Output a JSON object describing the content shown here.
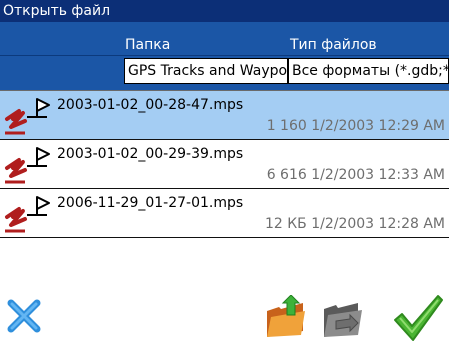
{
  "window": {
    "title": "Открыть файл"
  },
  "filters": {
    "folder_label": "Папка",
    "folder_value": "GPS Tracks and Waypoints",
    "type_label": "Тип файлов",
    "type_value": "Все форматы (*.gdb;*.mps)"
  },
  "files": [
    {
      "name": "2003-01-02_00-28-47.mps",
      "details": "1 160 1/2/2003 12:29 AM",
      "selected": true,
      "icon": "gps-track-file-icon"
    },
    {
      "name": "2003-01-02_00-29-39.mps",
      "details": "6 616 1/2/2003 12:33 AM",
      "selected": false,
      "icon": "gps-track-file-icon"
    },
    {
      "name": "2006-11-29_01-27-01.mps",
      "details": "12 КБ 1/2/2003 12:28 AM",
      "selected": false,
      "icon": "gps-track-file-icon"
    }
  ],
  "toolbar": {
    "cancel_icon": "cancel-x-icon",
    "up_folder_icon": "folder-up-icon",
    "new_folder_icon": "folder-icon",
    "ok_icon": "checkmark-icon"
  },
  "colors": {
    "titlebar": "#0c2f77",
    "filter_band": "#1b56a6",
    "selection": "#a4cdf3",
    "cancel_blue": "#2f8fdc",
    "ok_green": "#4ab532"
  }
}
